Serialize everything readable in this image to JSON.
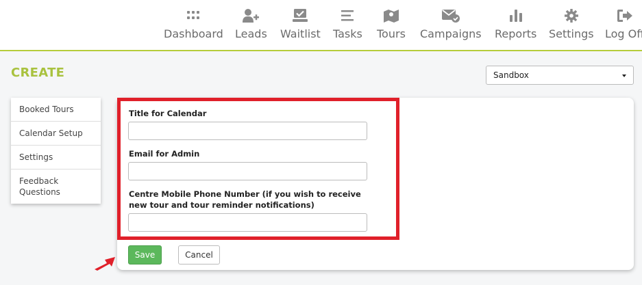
{
  "nav": {
    "items": [
      {
        "label": "Dashboard",
        "icon": "grid-icon"
      },
      {
        "label": "Leads",
        "icon": "add-user-icon"
      },
      {
        "label": "Waitlist",
        "icon": "tray-check-icon"
      },
      {
        "label": "Tasks",
        "icon": "list-lines-icon"
      },
      {
        "label": "Tours",
        "icon": "map-pin-icon"
      },
      {
        "label": "Campaigns",
        "icon": "envelope-check-icon"
      },
      {
        "label": "Reports",
        "icon": "bar-chart-icon"
      },
      {
        "label": "Settings",
        "icon": "gear-icon"
      },
      {
        "label": "Log Off",
        "icon": "sign-out-icon"
      }
    ]
  },
  "page": {
    "title": "CREATE"
  },
  "centre_select": {
    "value": "Sandbox"
  },
  "sidemenu": {
    "items": [
      {
        "label": "Booked Tours"
      },
      {
        "label": "Calendar Setup"
      },
      {
        "label": "Settings"
      },
      {
        "label": "Feedback Questions"
      }
    ]
  },
  "form": {
    "title_label": "Title for Calendar",
    "title_value": "",
    "email_label": "Email for Admin",
    "email_value": "",
    "phone_label": "Centre Mobile Phone Number (if you wish to receive new tour and tour reminder notifications)",
    "phone_value": ""
  },
  "actions": {
    "save_label": "Save",
    "cancel_label": "Cancel"
  },
  "colors": {
    "accent": "#a9c23f",
    "highlight": "#e0202a",
    "save": "#5cb85c",
    "icon": "#8a8a8a"
  }
}
